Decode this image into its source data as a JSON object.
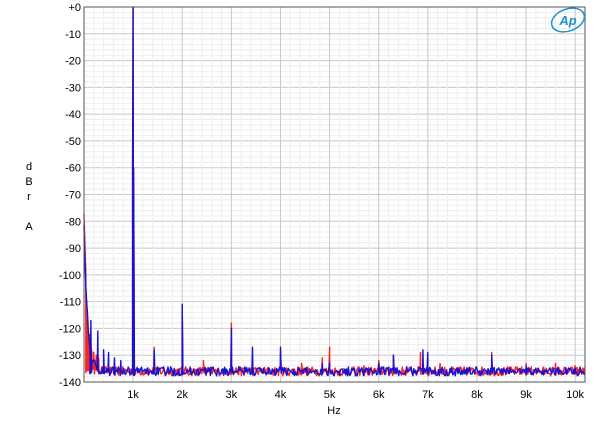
{
  "chart_data": {
    "type": "line",
    "title": "",
    "xlabel": "Hz",
    "ylabel_letters": [
      "d",
      "B",
      "r",
      "",
      "A"
    ],
    "xlim": [
      0,
      10200
    ],
    "ylim": [
      -140,
      0
    ],
    "x_ticks": [
      {
        "value": 1000,
        "label": "1k"
      },
      {
        "value": 2000,
        "label": "2k"
      },
      {
        "value": 3000,
        "label": "3k"
      },
      {
        "value": 4000,
        "label": "4k"
      },
      {
        "value": 5000,
        "label": "5k"
      },
      {
        "value": 6000,
        "label": "6k"
      },
      {
        "value": 7000,
        "label": "7k"
      },
      {
        "value": 8000,
        "label": "8k"
      },
      {
        "value": 9000,
        "label": "9k"
      },
      {
        "value": 10000,
        "label": "10k"
      }
    ],
    "y_ticks": [
      {
        "value": 0,
        "label": "+0"
      },
      {
        "value": -10,
        "label": "-10"
      },
      {
        "value": -20,
        "label": "-20"
      },
      {
        "value": -30,
        "label": "-30"
      },
      {
        "value": -40,
        "label": "-40"
      },
      {
        "value": -50,
        "label": "-50"
      },
      {
        "value": -60,
        "label": "-60"
      },
      {
        "value": -70,
        "label": "-70"
      },
      {
        "value": -80,
        "label": "-80"
      },
      {
        "value": -90,
        "label": "-90"
      },
      {
        "value": -100,
        "label": "-100"
      },
      {
        "value": -110,
        "label": "-110"
      },
      {
        "value": -120,
        "label": "-120"
      },
      {
        "value": -130,
        "label": "-130"
      },
      {
        "value": -140,
        "label": "-140"
      }
    ],
    "grid": true,
    "minor_grid": true,
    "legend": "none",
    "noise_floor": -136,
    "series": [
      {
        "color": "#ff2020",
        "start_level": -76,
        "peaks": [
          [
            50,
            -122
          ],
          [
            100,
            -126
          ],
          [
            150,
            -128
          ],
          [
            200,
            -129
          ],
          [
            250,
            -130
          ],
          [
            300,
            -131
          ],
          [
            1000,
            0
          ],
          [
            1430,
            -127
          ],
          [
            2000,
            -111
          ],
          [
            2430,
            -132
          ],
          [
            3000,
            -118
          ],
          [
            3430,
            -131
          ],
          [
            4000,
            -129
          ],
          [
            4430,
            -133
          ],
          [
            4850,
            -131
          ],
          [
            5000,
            -127
          ],
          [
            5700,
            -134
          ],
          [
            6000,
            -132
          ],
          [
            6300,
            -130
          ],
          [
            6850,
            -129
          ],
          [
            7000,
            -130
          ],
          [
            7250,
            -133
          ],
          [
            8300,
            -129
          ],
          [
            9000,
            -133
          ],
          [
            9600,
            -133
          ],
          [
            10000,
            -134
          ]
        ]
      },
      {
        "color": "#1414d2",
        "start_level": -80,
        "peaks": [
          [
            140,
            -117
          ],
          [
            280,
            -121
          ],
          [
            400,
            -128
          ],
          [
            500,
            -129
          ],
          [
            620,
            -131
          ],
          [
            750,
            -132
          ],
          [
            1000,
            0
          ],
          [
            1430,
            -128
          ],
          [
            2000,
            -111
          ],
          [
            3000,
            -120
          ],
          [
            3430,
            -127
          ],
          [
            4000,
            -127
          ],
          [
            4850,
            -133
          ],
          [
            5000,
            -133
          ],
          [
            6000,
            -133
          ],
          [
            6300,
            -130
          ],
          [
            6900,
            -128
          ],
          [
            7000,
            -129
          ],
          [
            8300,
            -130
          ],
          [
            9000,
            -134
          ],
          [
            10000,
            -135
          ]
        ]
      }
    ]
  },
  "logo": {
    "text": "Ap"
  }
}
